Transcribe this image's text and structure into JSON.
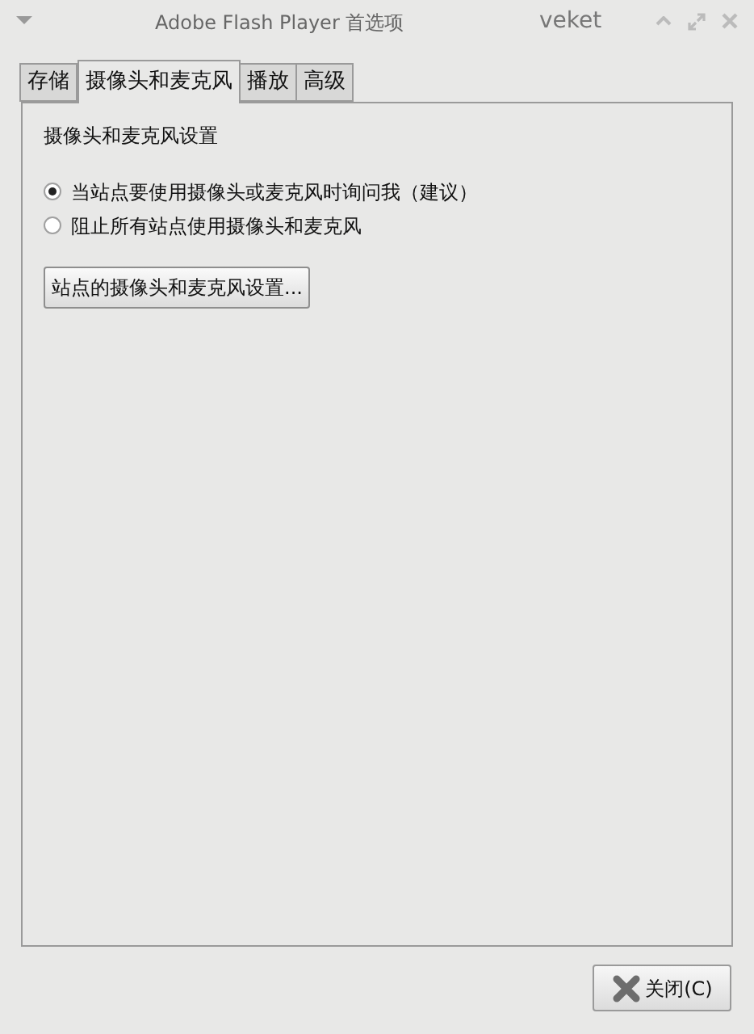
{
  "window": {
    "title": "Adobe Flash Player 首选项",
    "host": "veket"
  },
  "tabs": [
    {
      "label": "存储",
      "selected": false
    },
    {
      "label": "摄像头和麦克风",
      "selected": true
    },
    {
      "label": "播放",
      "selected": false
    },
    {
      "label": "高级",
      "selected": false
    }
  ],
  "section_title": "摄像头和麦克风设置",
  "options": [
    {
      "label": "当站点要使用摄像头或麦克风时询问我（建议）",
      "selected": true
    },
    {
      "label": "阻止所有站点使用摄像头和麦克风",
      "selected": false
    }
  ],
  "settings_button": "站点的摄像头和麦克风设置...",
  "close_button": "关闭(C)"
}
